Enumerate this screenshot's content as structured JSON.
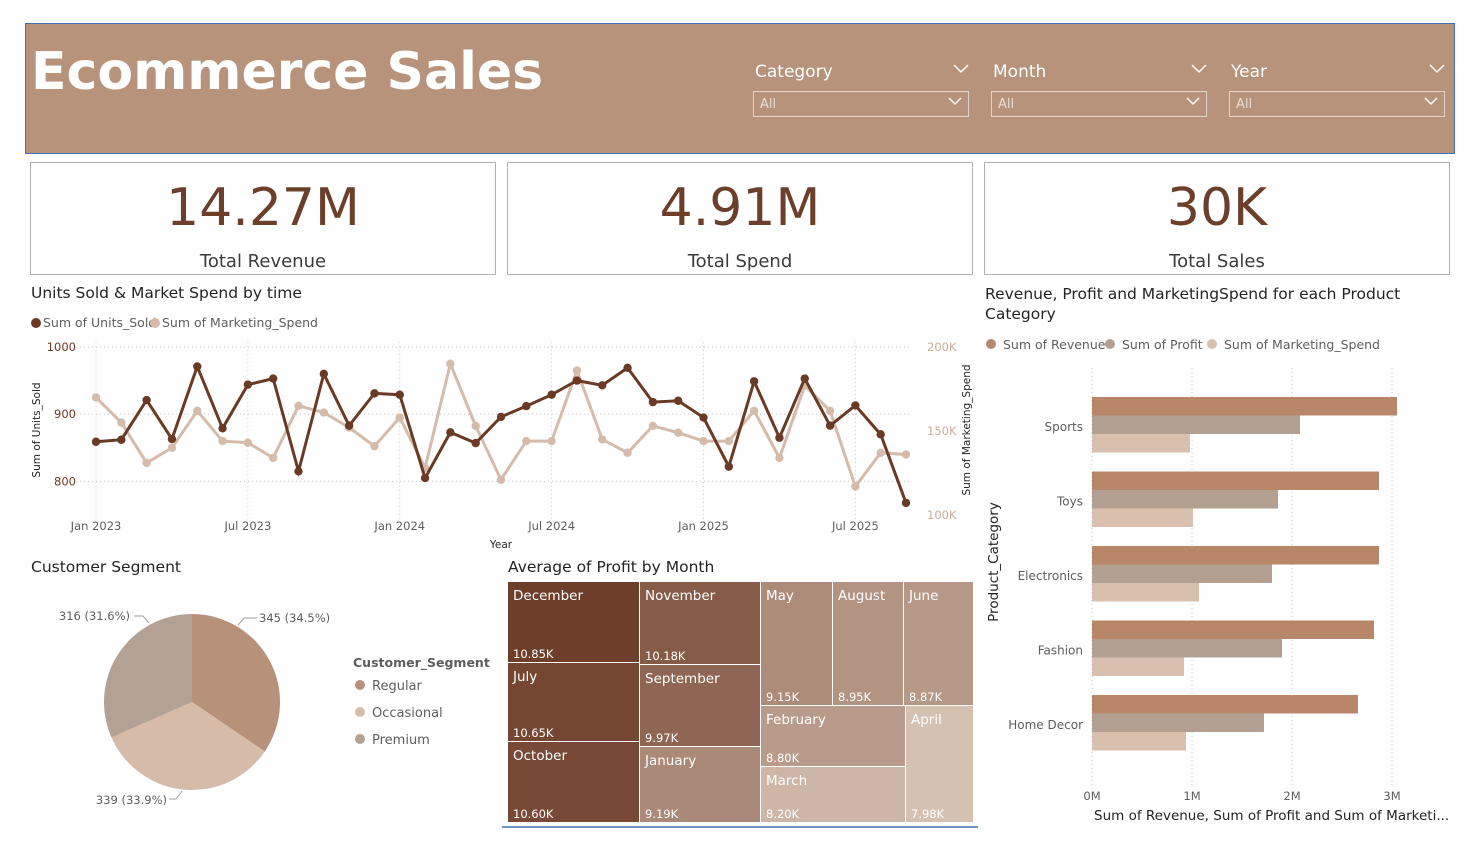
{
  "header": {
    "title": "Ecommerce Sales",
    "slicers": [
      {
        "label": "Category",
        "value": "All"
      },
      {
        "label": "Month",
        "value": "All"
      },
      {
        "label": "Year",
        "value": "All"
      }
    ]
  },
  "kpis": [
    {
      "value": "14.27M",
      "label": "Total Revenue"
    },
    {
      "value": "4.91M",
      "label": "Total Spend"
    },
    {
      "value": "30K",
      "label": "Total Sales"
    }
  ],
  "colors": {
    "header_bg": "#b8937b",
    "kpi_value": "#6b3f2a",
    "units": "#6b3a24",
    "marketing": "#d5bba9",
    "revenue": "#b8876a",
    "profit": "#b3a091",
    "marketing_bar": "#d9bfae",
    "seg_regular": "#b8917a",
    "seg_occasional": "#d6bba8",
    "seg_premium": "#b3a193"
  },
  "chart_data": [
    {
      "id": "line",
      "type": "line",
      "title": "Units Sold & Market Spend by time",
      "xlabel": "Year",
      "ylabel": "Sum of Units_Sold",
      "y2label": "Sum of Marketing_Spend",
      "x_ticks": [
        "Jan 2023",
        "Jul 2023",
        "Jan 2024",
        "Jul 2024",
        "Jan 2025",
        "Jul 2025"
      ],
      "y_ticks": [
        "1000",
        "900",
        "800"
      ],
      "y2_ticks": [
        "200K",
        "150K",
        "100K"
      ],
      "ylim": [
        750,
        1000
      ],
      "y2lim": [
        100000,
        200000
      ],
      "x": [
        "2023-01",
        "2023-02",
        "2023-03",
        "2023-04",
        "2023-05",
        "2023-06",
        "2023-07",
        "2023-08",
        "2023-09",
        "2023-10",
        "2023-11",
        "2023-12",
        "2024-01",
        "2024-02",
        "2024-03",
        "2024-04",
        "2024-05",
        "2024-06",
        "2024-07",
        "2024-08",
        "2024-09",
        "2024-10",
        "2024-11",
        "2024-12",
        "2025-01",
        "2025-02",
        "2025-03",
        "2025-04",
        "2025-05",
        "2025-06",
        "2025-07",
        "2025-08",
        "2025-09"
      ],
      "series": [
        {
          "name": "Sum of Units_Sold",
          "axis": "y",
          "values": [
            859,
            862,
            921,
            863,
            971,
            879,
            944,
            953,
            815,
            960,
            883,
            931,
            929,
            805,
            873,
            857,
            896,
            912,
            929,
            950,
            943,
            969,
            918,
            920,
            895,
            822,
            949,
            865,
            953,
            883,
            913,
            870,
            768
          ]
        },
        {
          "name": "Sum of Marketing_Spend",
          "axis": "y2",
          "values": [
            170000,
            155000,
            131000,
            140000,
            162000,
            144000,
            143000,
            134000,
            165000,
            161000,
            152000,
            141000,
            158000,
            128000,
            190000,
            153000,
            121000,
            144000,
            144000,
            186000,
            145000,
            137000,
            153000,
            149000,
            144000,
            144000,
            162000,
            134000,
            177000,
            162000,
            117000,
            137000,
            136000
          ]
        }
      ]
    },
    {
      "id": "pie",
      "type": "pie",
      "title": "Customer Segment",
      "legend_title": "Customer_Segment",
      "categories": [
        "Regular",
        "Occasional",
        "Premium"
      ],
      "values": [
        345,
        339,
        316
      ],
      "labels": [
        "345 (34.5%)",
        "339 (33.9%)",
        "316 (31.6%)"
      ]
    },
    {
      "id": "treemap",
      "type": "treemap",
      "title": "Average of Profit by Month",
      "categories": [
        "December",
        "November",
        "July",
        "September",
        "October",
        "January",
        "May",
        "August",
        "June",
        "February",
        "March",
        "April"
      ],
      "values": [
        10.85,
        10.18,
        10.65,
        9.97,
        10.6,
        9.19,
        9.15,
        8.95,
        8.87,
        8.8,
        8.2,
        7.98
      ],
      "labels": [
        "10.85K",
        "10.18K",
        "10.65K",
        "9.97K",
        "10.60K",
        "9.19K",
        "9.15K",
        "8.95K",
        "8.87K",
        "8.80K",
        "8.20K",
        "7.98K"
      ]
    },
    {
      "id": "bars",
      "type": "bar",
      "orientation": "horizontal",
      "title": "Revenue, Profit and MarketingSpend for each Product Category",
      "xlabel": "Sum of Revenue, Sum of Profit and Sum of Marketi...",
      "ylabel": "Product_Category",
      "categories": [
        "Sports",
        "Toys",
        "Electronics",
        "Fashion",
        "Home Decor"
      ],
      "x_ticks": [
        "0M",
        "1M",
        "2M",
        "3M"
      ],
      "xlim": [
        0,
        3100000
      ],
      "series": [
        {
          "name": "Sum of Revenue",
          "values": [
            3050000,
            2870000,
            2870000,
            2820000,
            2660000
          ]
        },
        {
          "name": "Sum of Profit",
          "values": [
            2080000,
            1860000,
            1800000,
            1900000,
            1720000
          ]
        },
        {
          "name": "Sum of Marketing_Spend",
          "values": [
            980000,
            1010000,
            1070000,
            920000,
            940000
          ]
        }
      ]
    }
  ]
}
